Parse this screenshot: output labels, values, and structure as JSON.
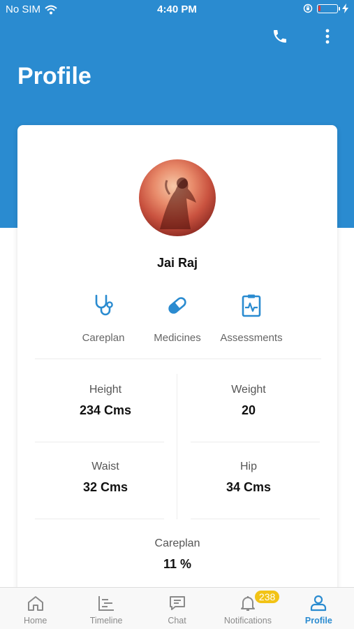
{
  "status_bar": {
    "carrier": "No SIM",
    "time": "4:40 PM"
  },
  "header": {
    "title": "Profile"
  },
  "profile": {
    "name": "Jai Raj"
  },
  "quick_actions": [
    {
      "label": "Careplan",
      "icon": "stethoscope-icon"
    },
    {
      "label": "Medicines",
      "icon": "pill-icon"
    },
    {
      "label": "Assessments",
      "icon": "clipboard-pulse-icon"
    }
  ],
  "metrics": {
    "height": {
      "label": "Height",
      "value": "234 Cms"
    },
    "weight": {
      "label": "Weight",
      "value": "20"
    },
    "waist": {
      "label": "Waist",
      "value": "32 Cms"
    },
    "hip": {
      "label": "Hip",
      "value": "34 Cms"
    },
    "careplan": {
      "label": "Careplan",
      "value": "11 %"
    }
  },
  "tabs": [
    {
      "label": "Home",
      "icon": "home-icon"
    },
    {
      "label": "Timeline",
      "icon": "timeline-icon"
    },
    {
      "label": "Chat",
      "icon": "chat-icon"
    },
    {
      "label": "Notifications",
      "icon": "bell-icon",
      "badge": "238"
    },
    {
      "label": "Profile",
      "icon": "person-icon",
      "active": true
    }
  ],
  "colors": {
    "primary": "#2a8bd0",
    "badge": "#f2c316",
    "inactive": "#8a8a8a"
  }
}
